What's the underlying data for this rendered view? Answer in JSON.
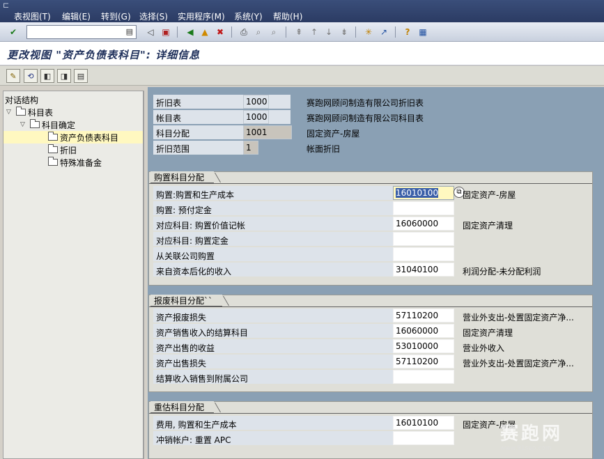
{
  "menu": {
    "items": [
      "表视图(T)",
      "编辑(E)",
      "转到(G)",
      "选择(S)",
      "实用程序(M)",
      "系统(Y)",
      "帮助(H)"
    ]
  },
  "toolbar": {
    "command_value": ""
  },
  "title": "更改视图 \"资产负债表科目\": 详细信息",
  "tree": {
    "header": "对话结构",
    "nodes": [
      {
        "label": "科目表"
      },
      {
        "label": "科目确定"
      },
      {
        "label": "资产负债表科目"
      },
      {
        "label": "折旧"
      },
      {
        "label": "特殊准备金"
      }
    ]
  },
  "header_fields": [
    {
      "label": "折旧表",
      "value": "1000",
      "desc": "赛跑网顾问制造有限公司折旧表"
    },
    {
      "label": "帐目表",
      "value": "1000",
      "desc": "赛跑网顾问制造有限公司科目表"
    },
    {
      "label": "科目分配",
      "value": "1001",
      "desc": "固定资产-房屋"
    },
    {
      "label": "折旧范围",
      "value": "1",
      "desc": "帐面折旧"
    }
  ],
  "groups": [
    {
      "title": "购置科目分配",
      "rows": [
        {
          "label": "购置:购置和生产成本",
          "value": "16010100",
          "desc": "固定资产-房屋"
        },
        {
          "label": "购置: 预付定金",
          "value": "",
          "desc": ""
        },
        {
          "label": "对应科目: 购置价值记帐",
          "value": "16060000",
          "desc": "固定资产清理"
        },
        {
          "label": "对应科目: 购置定金",
          "value": "",
          "desc": ""
        },
        {
          "label": "从关联公司购置",
          "value": "",
          "desc": ""
        },
        {
          "label": "来自资本后化的收入",
          "value": "31040100",
          "desc": "利润分配-未分配利润"
        }
      ]
    },
    {
      "title": "报废科目分配``",
      "rows": [
        {
          "label": "资产报废损失",
          "value": "57110200",
          "desc": "营业外支出-处置固定资产净..."
        },
        {
          "label": "资产销售收入的结算科目",
          "value": "16060000",
          "desc": "固定资产清理"
        },
        {
          "label": "资产出售的收益",
          "value": "53010000",
          "desc": "营业外收入"
        },
        {
          "label": "资产出售损失",
          "value": "57110200",
          "desc": "营业外支出-处置固定资产净..."
        },
        {
          "label": "结算收入销售到附属公司",
          "value": "",
          "desc": ""
        }
      ]
    },
    {
      "title": "重估科目分配",
      "rows": [
        {
          "label": "费用, 购置和生产成本",
          "value": "16010100",
          "desc": "固定资产-房屋"
        },
        {
          "label": "冲销帐户: 重置 APC",
          "value": "",
          "desc": ""
        }
      ]
    }
  ],
  "watermark": {
    "text": "赛跑网",
    "url": "www.91sap.com"
  },
  "colors": {
    "menu_bg": "#2b3b63",
    "right_bg": "#8aa0b4",
    "group_bg": "#dfdfd8",
    "selected": "#fff8c0"
  }
}
